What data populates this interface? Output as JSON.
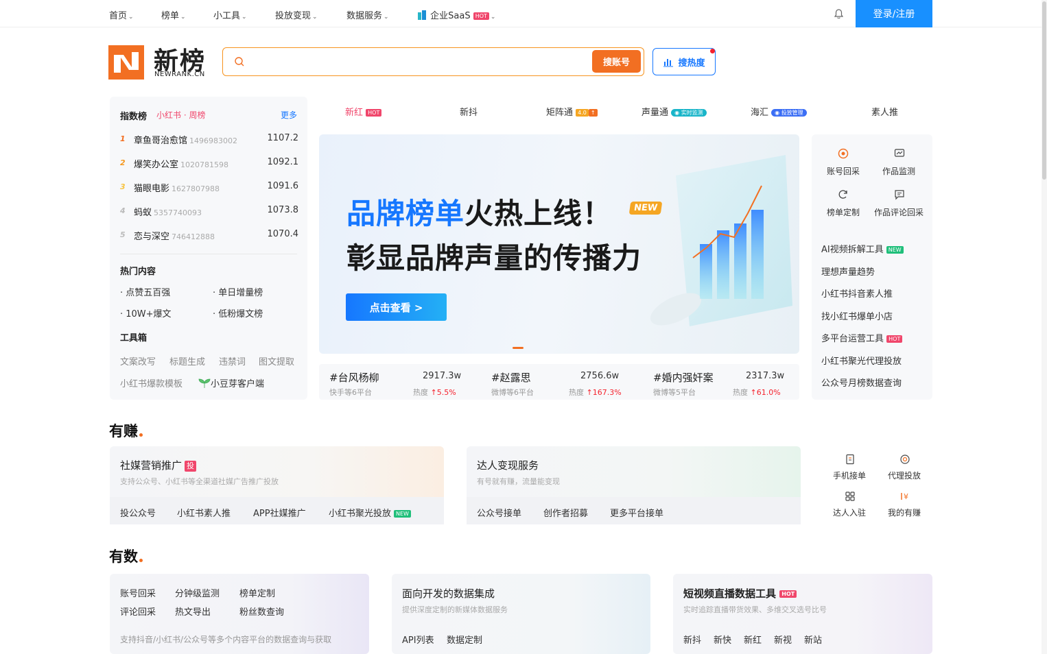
{
  "topnav": {
    "items": [
      "首页",
      "榜单",
      "小工具",
      "投放变现",
      "数据服务"
    ],
    "saas_label": "企业SaaS",
    "hot_badge": "HOT",
    "login_label": "登录/注册"
  },
  "logo": {
    "name": "新榜",
    "sub": "NEWRANK.CN"
  },
  "search": {
    "placeholder": "",
    "button": "搜账号",
    "hot_button": "搜热度"
  },
  "index_rank": {
    "title": "指数榜",
    "tag": "小红书 · 周榜",
    "more": "更多",
    "rows": [
      {
        "rank": "1",
        "name": "章鱼哥治愈馆",
        "id": "1496983002",
        "value": "1107.2"
      },
      {
        "rank": "2",
        "name": "爆笑办公室",
        "id": "1020781598",
        "value": "1092.1"
      },
      {
        "rank": "3",
        "name": "猫眼电影",
        "id": "1627807988",
        "value": "1091.6"
      },
      {
        "rank": "4",
        "name": "蚂蚁",
        "id": "5357740093",
        "value": "1073.8"
      },
      {
        "rank": "5",
        "name": "恋与深空",
        "id": "746412888",
        "value": "1070.4"
      }
    ]
  },
  "hot_content": {
    "title": "热门内容",
    "links": [
      "· 点赞五百强",
      "· 单日增量榜",
      "· 10W+爆文",
      "· 低粉爆文榜"
    ]
  },
  "toolbox": {
    "title": "工具箱",
    "links": [
      "文案改写",
      "标题生成",
      "违禁词",
      "图文提取",
      "小红书爆款模板",
      "小豆芽客户端"
    ]
  },
  "platform_tabs": [
    {
      "label": "新红",
      "badge": "HOT"
    },
    {
      "label": "新抖",
      "badge": ""
    },
    {
      "label": "矩阵通",
      "badge": "4.0"
    },
    {
      "label": "声量通",
      "badge": "实时监测"
    },
    {
      "label": "海汇",
      "badge": "投放管理"
    },
    {
      "label": "素人推",
      "badge": ""
    }
  ],
  "banner": {
    "line1_blue": "品牌榜单",
    "line1_rest": "火热上线！",
    "new_badge": "NEW",
    "line2": "彰显品牌声量的传播力",
    "button": "点击查看 >"
  },
  "trending": [
    {
      "tag": "#台风杨柳",
      "platform": "快手等6平台",
      "num": "2917.3w",
      "heat_label": "热度",
      "heat": "5.5%"
    },
    {
      "tag": "#赵露思",
      "platform": "微博等6平台",
      "num": "2756.6w",
      "heat_label": "热度",
      "heat": "167.3%"
    },
    {
      "tag": "#婚内强奸案",
      "platform": "微博等5平台",
      "num": "2317.3w",
      "heat_label": "热度",
      "heat": "61.0%"
    }
  ],
  "right_panel": {
    "grid": [
      "账号回采",
      "作品监测",
      "榜单定制",
      "作品评论回采"
    ],
    "links": [
      {
        "label": "AI视频拆解工具",
        "badge": "NEW"
      },
      {
        "label": "理想声量趋势",
        "badge": ""
      },
      {
        "label": "小红书抖音素人推",
        "badge": ""
      },
      {
        "label": "找小红书爆单小店",
        "badge": ""
      },
      {
        "label": "多平台运营工具",
        "badge": "HOT"
      },
      {
        "label": "小红书聚光代理投放",
        "badge": ""
      },
      {
        "label": "公众号月榜数据查询",
        "badge": ""
      }
    ]
  },
  "earn": {
    "title": "有赚",
    "card1": {
      "title": "社媒营销推广",
      "badge": "投",
      "sub": "支持公众号、小红书等全渠道社媒广告推广投放",
      "links": [
        "投公众号",
        "小红书素人推",
        "APP社媒推广",
        "小红书聚光投放"
      ],
      "new_badge": "NEW"
    },
    "card2": {
      "title": "达人变现服务",
      "sub": "有号就有赚，流量能变现",
      "links": [
        "公众号接单",
        "创作者招募",
        "更多平台接单"
      ]
    },
    "side": [
      "手机接单",
      "代理投放",
      "达人入驻",
      "我的有赚"
    ]
  },
  "data": {
    "title": "有数",
    "card1": {
      "links": [
        "账号回采",
        "分钟级监测",
        "榜单定制",
        "评论回采",
        "热文导出",
        "粉丝数查询"
      ],
      "sub": "支持抖音/小红书/公众号等多个内容平台的数据查询与获取"
    },
    "card2": {
      "title": "面向开发的数据集成",
      "sub": "提供深度定制的新媒体数据服务",
      "links": [
        "API列表",
        "数据定制"
      ]
    },
    "card3": {
      "title": "短视频直播数据工具",
      "badge": "HOT",
      "sub": "实时追踪直播带货效果、多维交叉选号比号",
      "links": [
        "新抖",
        "新快",
        "新红",
        "新视",
        "新站"
      ]
    }
  }
}
